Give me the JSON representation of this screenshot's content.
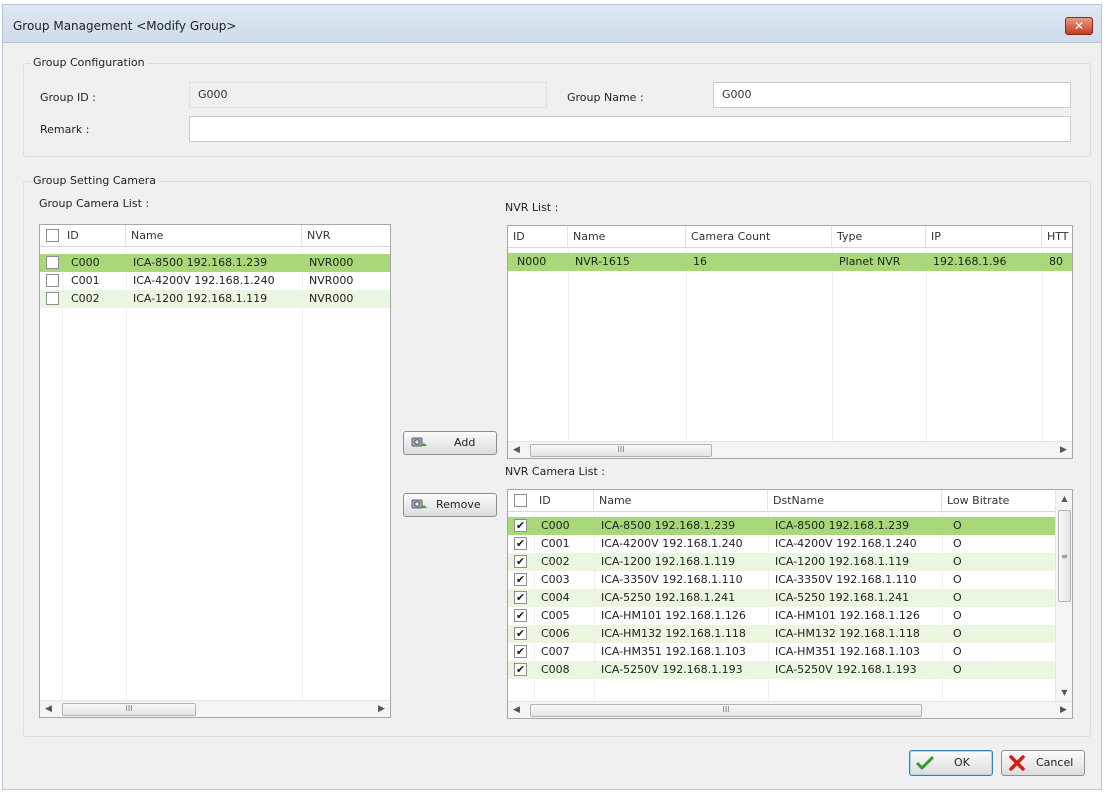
{
  "window": {
    "title": "Group Management  <Modify Group>",
    "close_label": "✕"
  },
  "group_config": {
    "title": "Group Configuration",
    "group_id_label": "Group ID :",
    "group_id_value": "G000",
    "group_name_label": "Group Name :",
    "group_name_value": "G000",
    "remark_label": "Remark :",
    "remark_value": ""
  },
  "group_setting": {
    "title": "Group Setting Camera",
    "group_camera_list_label": "Group Camera List :",
    "nvr_list_label": "NVR List :",
    "nvr_camera_list_label": "NVR Camera List :"
  },
  "group_camera_list": {
    "columns": [
      "ID",
      "Name",
      "NVR"
    ],
    "rows": [
      [
        "C000",
        "ICA-8500 192.168.1.239",
        "NVR000"
      ],
      [
        "C001",
        "ICA-4200V 192.168.1.240",
        "NVR000"
      ],
      [
        "C002",
        "ICA-1200 192.168.1.119",
        "NVR000"
      ]
    ],
    "scroll_grip": "III"
  },
  "nvr_list": {
    "columns": [
      "ID",
      "Name",
      "Camera Count",
      "Type",
      "IP",
      "HTT"
    ],
    "rows": [
      [
        "N000",
        "NVR-1615",
        "16",
        "Planet NVR",
        "192.168.1.96",
        "80"
      ]
    ],
    "scroll_grip": "III"
  },
  "nvr_camera_list": {
    "columns": [
      "ID",
      "Name",
      "DstName",
      "Low Bitrate"
    ],
    "rows": [
      [
        "C000",
        "ICA-8500 192.168.1.239",
        "ICA-8500 192.168.1.239",
        "O"
      ],
      [
        "C001",
        "ICA-4200V 192.168.1.240",
        "ICA-4200V 192.168.1.240",
        "O"
      ],
      [
        "C002",
        "ICA-1200 192.168.1.119",
        "ICA-1200 192.168.1.119",
        "O"
      ],
      [
        "C003",
        "ICA-3350V 192.168.1.110",
        "ICA-3350V 192.168.1.110",
        "O"
      ],
      [
        "C004",
        "ICA-5250 192.168.1.241",
        "ICA-5250 192.168.1.241",
        "O"
      ],
      [
        "C005",
        "ICA-HM101 192.168.1.126",
        "ICA-HM101 192.168.1.126",
        "O"
      ],
      [
        "C006",
        "ICA-HM132 192.168.1.118",
        "ICA-HM132 192.168.1.118",
        "O"
      ],
      [
        "C007",
        "ICA-HM351 192.168.1.103",
        "ICA-HM351 192.168.1.103",
        "O"
      ],
      [
        "C008",
        "ICA-5250V 192.168.1.193",
        "ICA-5250V 192.168.1.193",
        "O"
      ]
    ],
    "check_mark": "✔",
    "scroll_grip": "III",
    "vscroll_grip": "≡"
  },
  "buttons": {
    "add": "Add",
    "remove": "Remove",
    "ok": "OK",
    "cancel": "Cancel"
  },
  "colors": {
    "selected_row": "#a8d878",
    "alt_row": "#eaf6df",
    "cancel_x": "#d02010",
    "ok_check": "#2f9b2f"
  }
}
